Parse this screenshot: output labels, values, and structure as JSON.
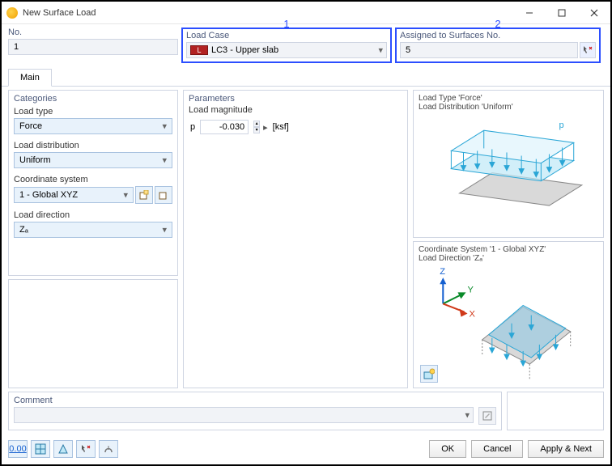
{
  "window": {
    "title": "New Surface Load"
  },
  "annotations": {
    "a1": "1",
    "a2": "2"
  },
  "top": {
    "no_label": "No.",
    "no_value": "1",
    "loadcase_label": "Load Case",
    "loadcase_chip": "L",
    "loadcase_value": "LC3 - Upper slab",
    "assigned_label": "Assigned to Surfaces No.",
    "assigned_value": "5"
  },
  "tabs": {
    "main": "Main"
  },
  "categories": {
    "title": "Categories",
    "load_type_label": "Load type",
    "load_type_value": "Force",
    "load_dist_label": "Load distribution",
    "load_dist_value": "Uniform",
    "coord_label": "Coordinate system",
    "coord_value": "1 - Global XYZ",
    "load_dir_label": "Load direction",
    "load_dir_value": "Zₐ"
  },
  "parameters": {
    "title": "Parameters",
    "magnitude_label": "Load magnitude",
    "magnitude_symbol": "p",
    "magnitude_value": "-0.030",
    "magnitude_unit": "[ksf]"
  },
  "preview": {
    "line1a": "Load Type 'Force'",
    "line1b": "Load Distribution 'Uniform'",
    "p_symbol": "p",
    "line2a": "Coordinate System '1 - Global XYZ'",
    "line2b": "Load Direction 'Zₐ'",
    "axis_z": "Z",
    "axis_y": "Y",
    "axis_x": "X"
  },
  "comment": {
    "title": "Comment",
    "value": ""
  },
  "toolbar": {
    "b1": "0.00"
  },
  "buttons": {
    "ok": "OK",
    "cancel": "Cancel",
    "applynext": "Apply & Next"
  }
}
